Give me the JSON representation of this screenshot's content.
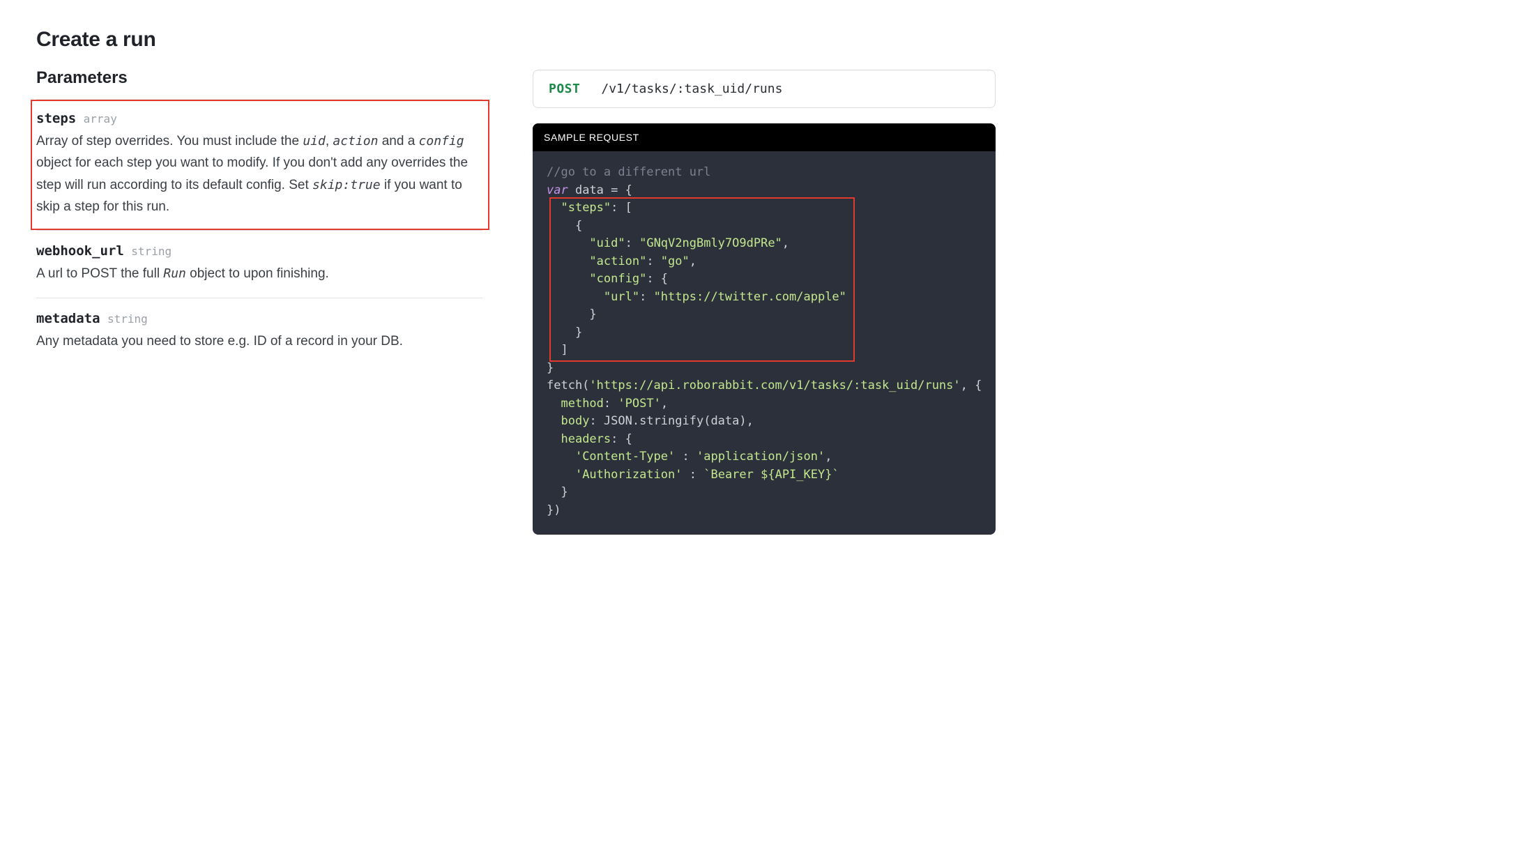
{
  "title": "Create a run",
  "parameters_heading": "Parameters",
  "params": {
    "steps": {
      "name": "steps",
      "type": "array",
      "desc_parts": {
        "t0": "Array of step overrides. You must include the ",
        "c0": "uid",
        "t1": ", ",
        "c1": "action",
        "t2": " and a ",
        "c2": "config",
        "t3": " object for each step you want to modify. If you don't add any overrides the step will run according to its default config. Set ",
        "c3": "skip:true",
        "t4": " if you want to skip a step for this run."
      }
    },
    "webhook_url": {
      "name": "webhook_url",
      "type": "string",
      "desc_parts": {
        "t0": "A url to POST the full ",
        "c0": "Run",
        "t1": " object to upon finishing."
      }
    },
    "metadata": {
      "name": "metadata",
      "type": "string",
      "desc": "Any metadata you need to store e.g. ID of a record in your DB."
    }
  },
  "endpoint": {
    "method": "POST",
    "path": "/v1/tasks/:task_uid/runs"
  },
  "sample_request": {
    "label": "SAMPLE REQUEST",
    "code": {
      "comment": "//go to a different url",
      "var_kw": "var",
      "var_name": "data",
      "steps_key": "\"steps\"",
      "uid_key": "\"uid\"",
      "uid_val": "\"GNqV2ngBmly7O9dPRe\"",
      "action_key": "\"action\"",
      "action_val": "\"go\"",
      "config_key": "\"config\"",
      "url_key": "\"url\"",
      "url_val": "\"https://twitter.com/apple\"",
      "fetch_url": "'https://api.roborabbit.com/v1/tasks/:task_uid/runs'",
      "method_key": "method",
      "method_val": "'POST'",
      "body_key": "body",
      "body_val": "JSON.stringify(data)",
      "headers_key": "headers",
      "ct_key": "'Content-Type'",
      "ct_val": "'application/json'",
      "auth_key": "'Authorization'",
      "auth_val": "`Bearer ${API_KEY}`"
    }
  }
}
